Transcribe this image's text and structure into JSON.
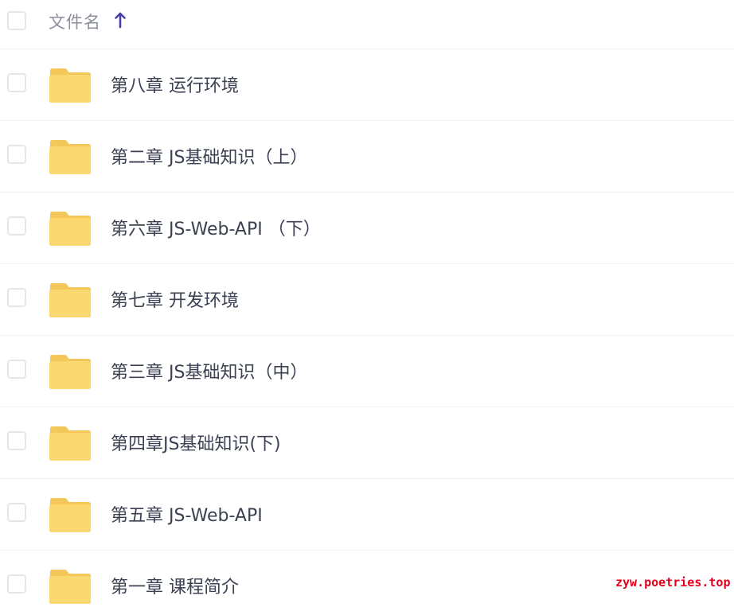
{
  "header": {
    "column_label": "文件名",
    "sort_icon": "arrow-up-icon",
    "sort_color": "#4b3fa6"
  },
  "folder_color": "#fbd76f",
  "files": [
    {
      "name": "第八章 运行环境",
      "icon": "folder-icon"
    },
    {
      "name": "第二章 JS基础知识（上）",
      "icon": "folder-icon"
    },
    {
      "name": "第六章 JS-Web-API （下）",
      "icon": "folder-icon"
    },
    {
      "name": "第七章 开发环境",
      "icon": "folder-icon"
    },
    {
      "name": "第三章 JS基础知识（中）",
      "icon": "folder-icon"
    },
    {
      "name": "第四章JS基础知识(下)",
      "icon": "folder-icon"
    },
    {
      "name": "第五章 JS-Web-API",
      "icon": "folder-icon"
    },
    {
      "name": "第一章 课程简介",
      "icon": "folder-icon"
    }
  ],
  "watermark": "zyw.poetries.top"
}
